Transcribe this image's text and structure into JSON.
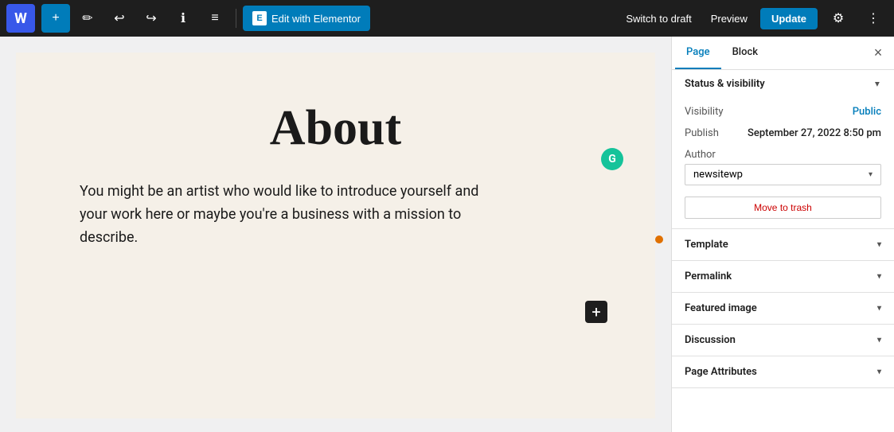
{
  "toolbar": {
    "wp_logo": "W",
    "add_label": "+",
    "pen_icon": "✏",
    "undo_icon": "↩",
    "redo_icon": "↪",
    "info_icon": "ℹ",
    "list_icon": "≡",
    "edit_with_elementor_label": "Edit with Elementor",
    "elementor_icon": "E",
    "switch_to_draft_label": "Switch to draft",
    "preview_label": "Preview",
    "update_label": "Update",
    "settings_icon": "⚙",
    "more_icon": "⋮"
  },
  "canvas": {
    "page_title": "About",
    "page_body": "You might be an artist who would like to introduce yourself and your work here or maybe you're a business with a mission to describe.",
    "grammarly_label": "G",
    "add_block_label": "+"
  },
  "sidebar": {
    "tab_page_label": "Page",
    "tab_block_label": "Block",
    "close_label": "×",
    "sections": {
      "status_visibility": {
        "label": "Status & visibility",
        "expanded": true,
        "visibility_label": "Visibility",
        "visibility_value": "Public",
        "publish_label": "Publish",
        "publish_value": "September 27, 2022 8:50 pm",
        "author_label": "Author",
        "author_value": "newsitewp",
        "move_to_trash_label": "Move to trash"
      },
      "template": {
        "label": "Template"
      },
      "permalink": {
        "label": "Permalink"
      },
      "featured_image": {
        "label": "Featured image"
      },
      "discussion": {
        "label": "Discussion"
      },
      "page_attributes": {
        "label": "Page Attributes"
      }
    }
  }
}
